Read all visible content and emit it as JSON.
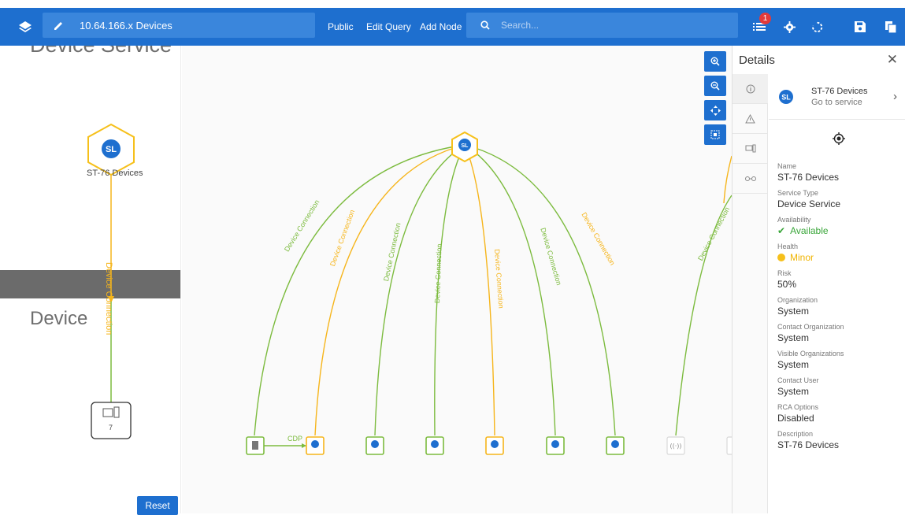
{
  "toolbar": {
    "title": "10.64.166.x Devices",
    "public_label": "Public",
    "edit_query_label": "Edit Query",
    "add_node_label": "Add Node",
    "search_placeholder": "Search...",
    "notification_count": "1"
  },
  "left_panel": {
    "lane_top_title": "Device Service",
    "lane_bottom_title": "Device",
    "service_node_label": "ST-76 Devices",
    "edge_label": "Device Connection",
    "device_group_count": "7",
    "reset_label": "Reset"
  },
  "canvas": {
    "edge_label": "Device Connection",
    "cdp_label": "CDP",
    "colors": {
      "green": "#7cbb3e",
      "orange": "#f6b51b",
      "blue": "#1e6fcf"
    }
  },
  "details": {
    "title": "Details",
    "service_name": "ST-76 Devices",
    "go_to_service": "Go to service",
    "fields": {
      "name_label": "Name",
      "name_value": "ST-76 Devices",
      "type_label": "Service Type",
      "type_value": "Device Service",
      "availability_label": "Availability",
      "availability_value": "Available",
      "health_label": "Health",
      "health_value": "Minor",
      "risk_label": "Risk",
      "risk_value": "50%",
      "org_label": "Organization",
      "org_value": "System",
      "contact_org_label": "Contact Organization",
      "contact_org_value": "System",
      "visible_orgs_label": "Visible Organizations",
      "visible_orgs_value": "System",
      "contact_user_label": "Contact User",
      "contact_user_value": "System",
      "rca_label": "RCA Options",
      "rca_value": "Disabled",
      "description_label": "Description",
      "description_value": "ST-76 Devices"
    }
  }
}
